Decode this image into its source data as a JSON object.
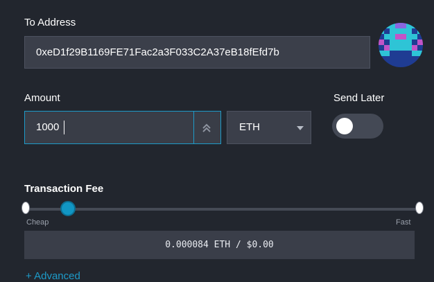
{
  "to_address": {
    "label": "To Address",
    "value": "0xeD1f29B1169FE71Fac2a3F033C2A37eB18fEfd7b"
  },
  "amount": {
    "label": "Amount",
    "value": "1000",
    "currency": "ETH"
  },
  "send_later": {
    "label": "Send Later",
    "enabled": false
  },
  "transaction_fee": {
    "label": "Transaction Fee",
    "min_label": "Cheap",
    "max_label": "Fast",
    "level": 0.09,
    "display": "0.000084 ETH / $0.00"
  },
  "advanced": {
    "label": "+ Advanced"
  },
  "colors": {
    "background": "#22262e",
    "field": "#3b3f4a",
    "accent": "#1d9bc9"
  }
}
